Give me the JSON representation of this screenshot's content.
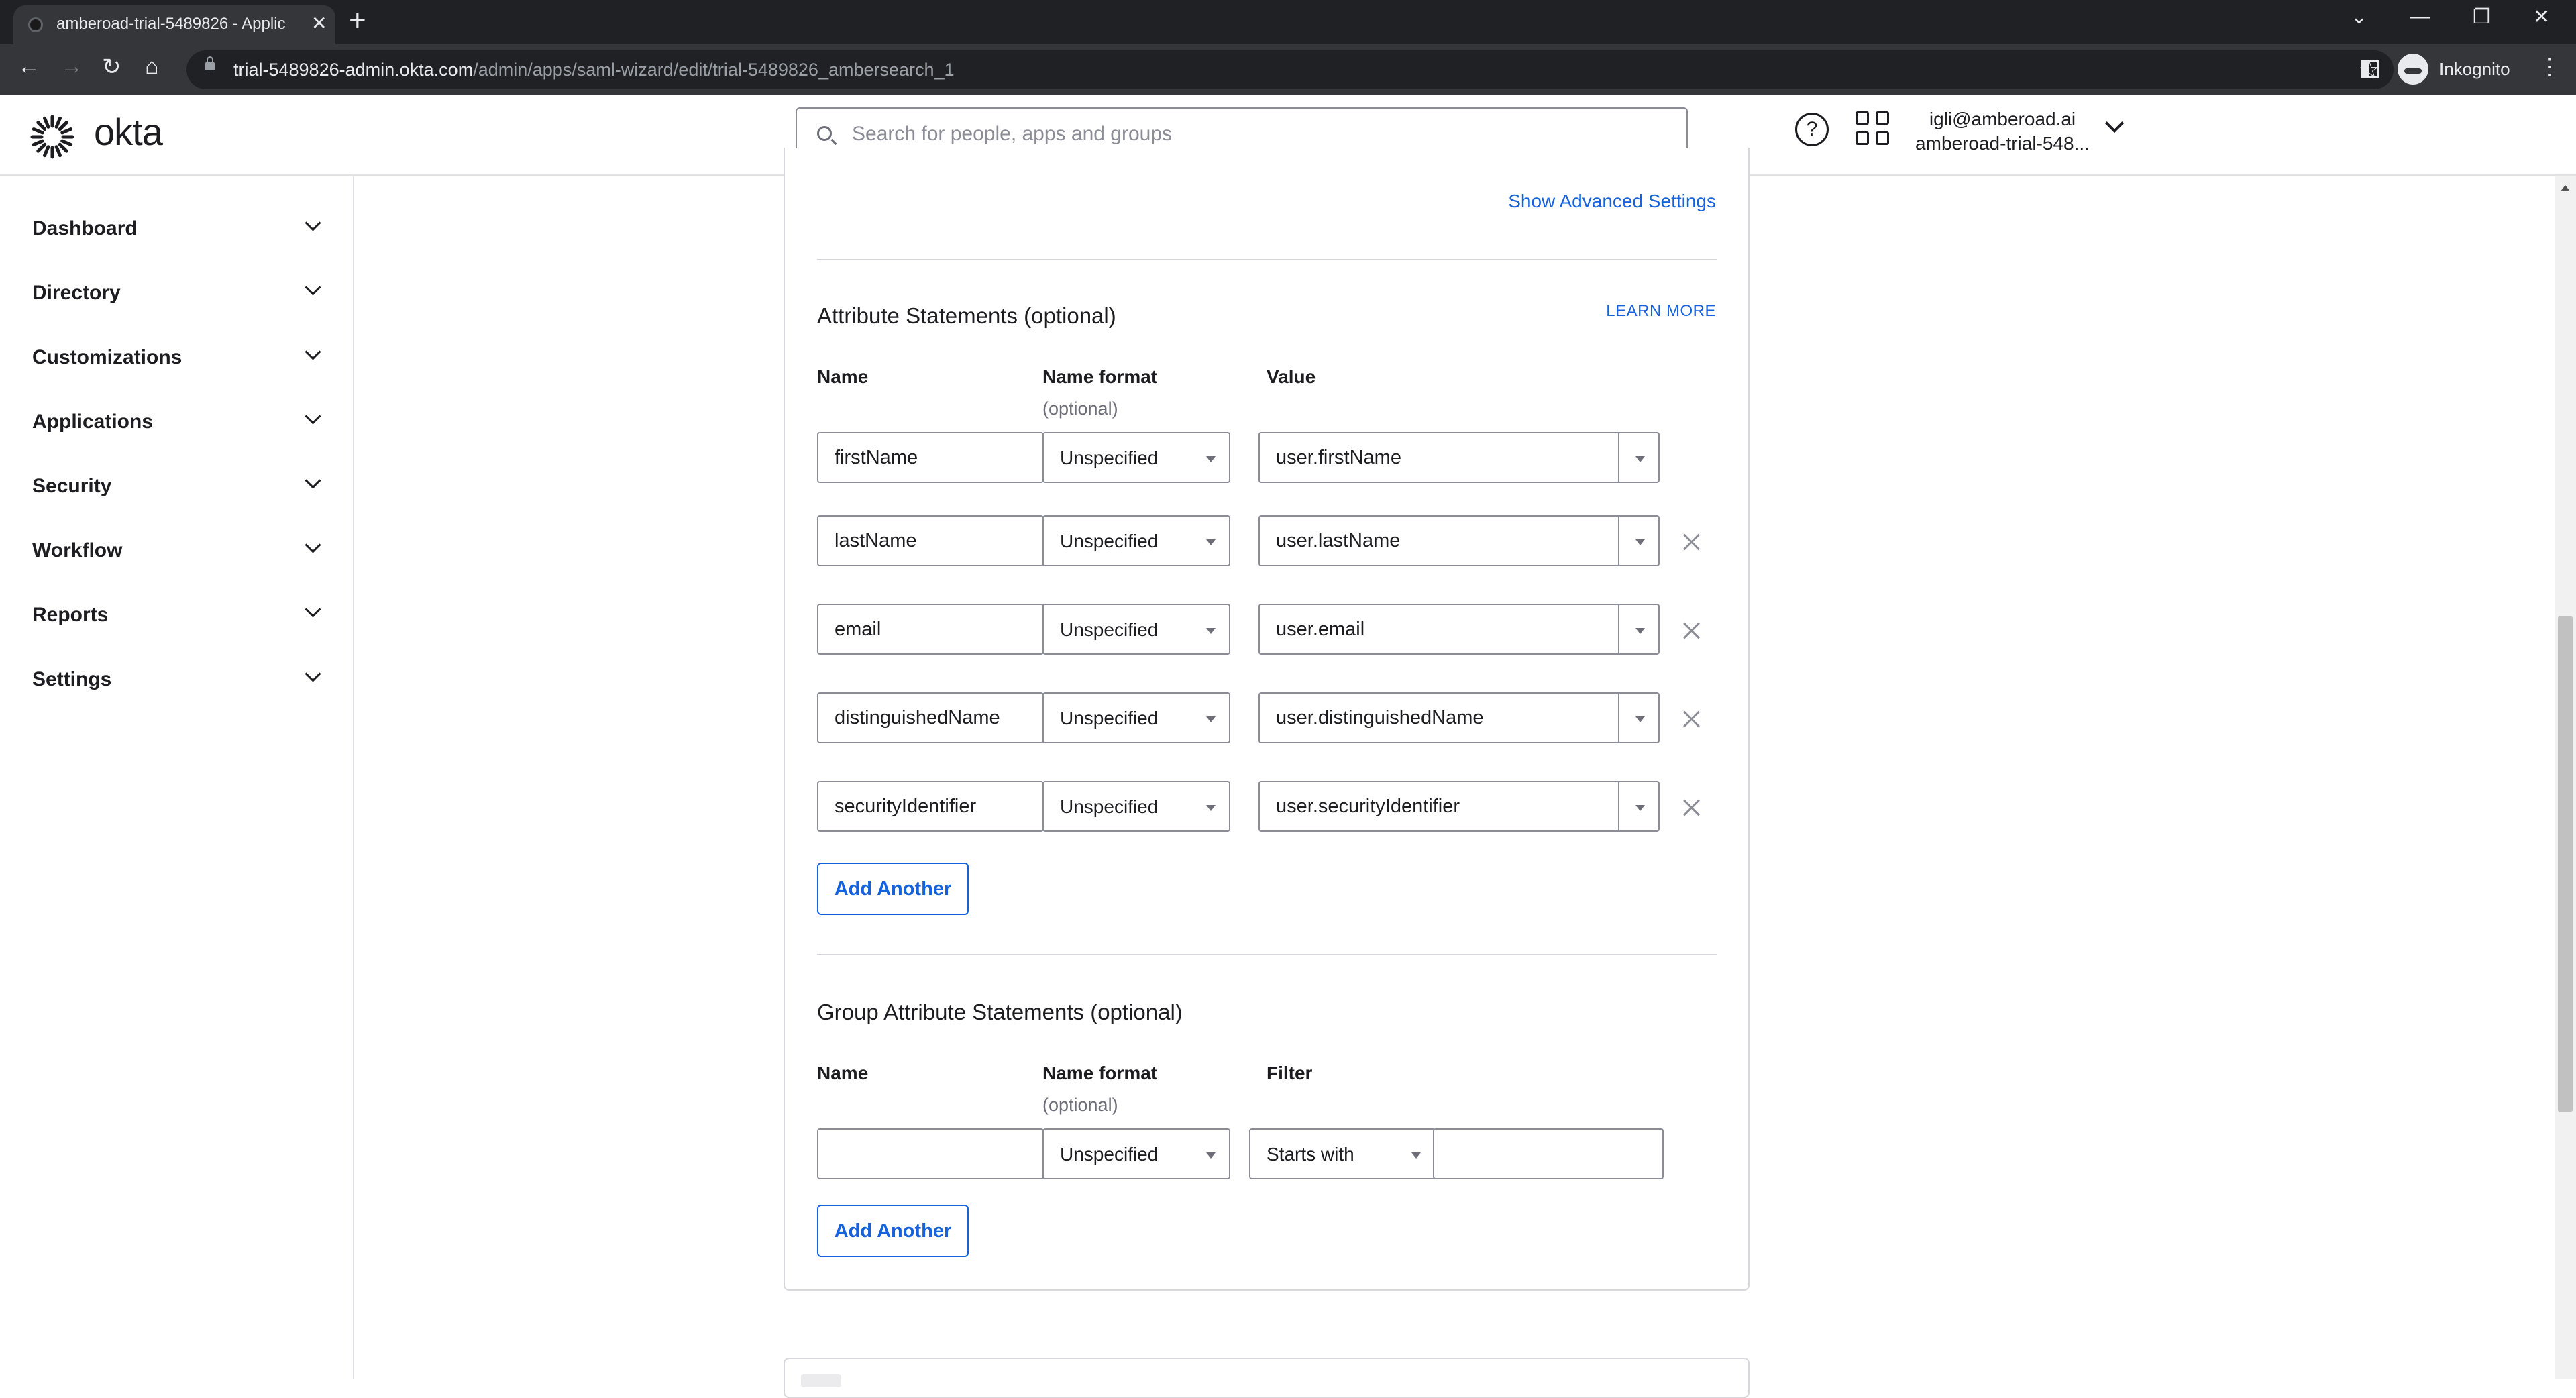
{
  "browser": {
    "tab_title": "amberoad-trial-5489826 - Applic",
    "url_host": "trial-5489826-admin.okta.com",
    "url_path": "/admin/apps/saml-wizard/edit/trial-5489826_ambersearch_1",
    "profile_label": "Inkognito"
  },
  "header": {
    "logo_text": "okta",
    "search_placeholder": "Search for people, apps and groups",
    "user_email": "igli@amberoad.ai",
    "user_org": "amberoad-trial-548..."
  },
  "sidebar": {
    "items": [
      {
        "label": "Dashboard"
      },
      {
        "label": "Directory"
      },
      {
        "label": "Customizations"
      },
      {
        "label": "Applications"
      },
      {
        "label": "Security"
      },
      {
        "label": "Workflow"
      },
      {
        "label": "Reports"
      },
      {
        "label": "Settings"
      }
    ]
  },
  "main": {
    "advanced_link": "Show Advanced Settings",
    "attributes": {
      "title": "Attribute Statements (optional)",
      "learn_more": "LEARN MORE",
      "col_name": "Name",
      "col_format": "Name format",
      "col_format_sub": "(optional)",
      "col_value": "Value",
      "rows": [
        {
          "name": "firstName",
          "format": "Unspecified",
          "value": "user.firstName"
        },
        {
          "name": "lastName",
          "format": "Unspecified",
          "value": "user.lastName"
        },
        {
          "name": "email",
          "format": "Unspecified",
          "value": "user.email"
        },
        {
          "name": "distinguishedName",
          "format": "Unspecified",
          "value": "user.distinguishedName"
        },
        {
          "name": "securityIdentifier",
          "format": "Unspecified",
          "value": "user.securityIdentifier"
        }
      ],
      "add_label": "Add Another"
    },
    "groups": {
      "title": "Group Attribute Statements (optional)",
      "col_name": "Name",
      "col_format": "Name format",
      "col_format_sub": "(optional)",
      "col_filter": "Filter",
      "row": {
        "name": "",
        "format": "Unspecified",
        "filter_type": "Starts with",
        "filter_value": ""
      },
      "add_label": "Add Another"
    }
  }
}
